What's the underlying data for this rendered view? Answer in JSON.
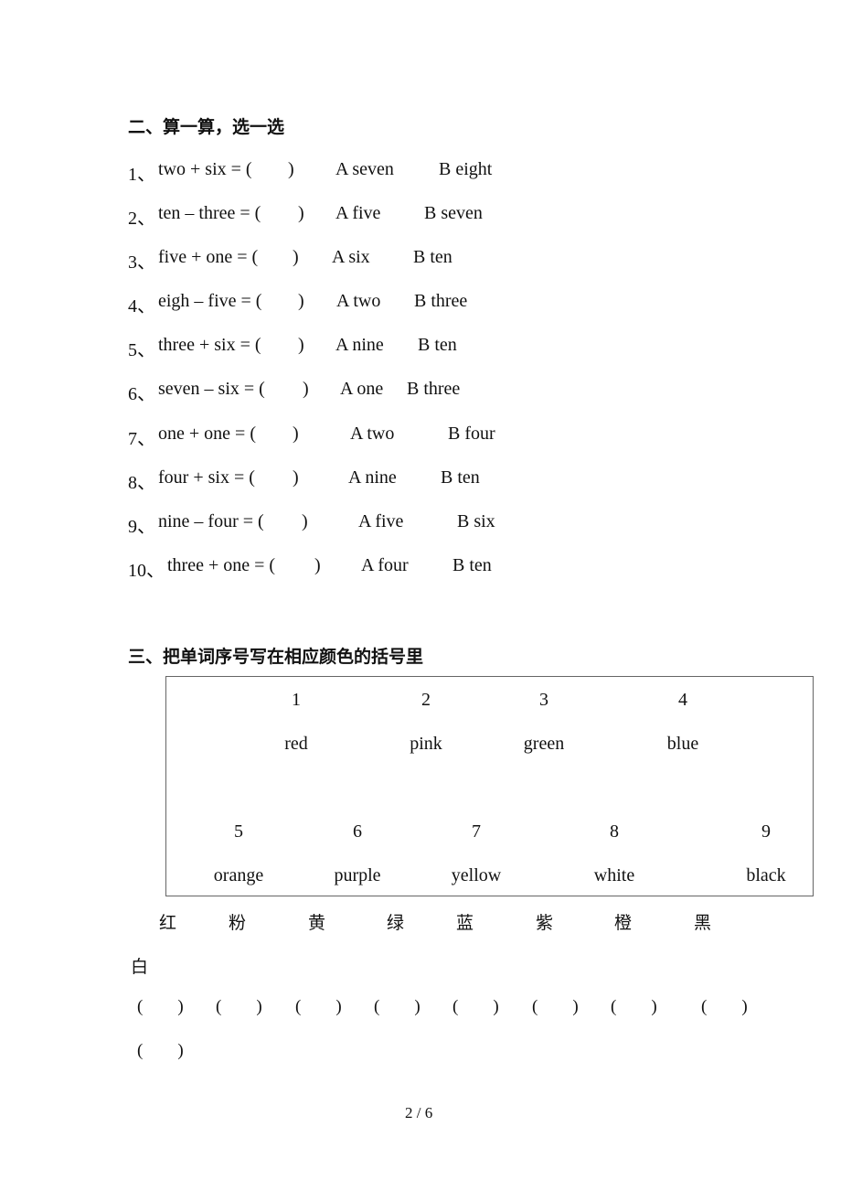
{
  "section2": {
    "title": "二、算一算，选一选",
    "questions": [
      {
        "num": "1、",
        "expr": "two + six = (",
        "close": ")",
        "a": "A seven",
        "b": "B eight"
      },
      {
        "num": "2、",
        "expr": "ten – three = (",
        "close": ")",
        "a": "A five",
        "b": "B seven"
      },
      {
        "num": "3、",
        "expr": "five + one = (",
        "close": ")",
        "a": "A six",
        "b": "B ten"
      },
      {
        "num": "4、",
        "expr": "eigh – five = (",
        "close": ")",
        "a": "A two",
        "b": "B three"
      },
      {
        "num": "5、",
        "expr": "three + six = (",
        "close": ")",
        "a": "A nine",
        "b": "B ten"
      },
      {
        "num": "6、",
        "expr": "seven – six = (",
        "close": ")",
        "a": "A one",
        "b": "B three"
      },
      {
        "num": "7、",
        "expr": "one + one = (",
        "close": ")",
        "a": "A two",
        "b": "B four"
      },
      {
        "num": "8、",
        "expr": "four + six = (",
        "close": ")",
        "a": "A nine",
        "b": "B ten"
      },
      {
        "num": "9、",
        "expr": "nine – four = (",
        "close": ")",
        "a": "A five",
        "b": "B six"
      },
      {
        "num": "10、",
        "expr": "three + one = (",
        "close": ")",
        "a": "A four",
        "b": "B ten"
      }
    ]
  },
  "section3": {
    "title": "三、把单词序号写在相应颜色的括号里",
    "words": [
      {
        "num": "1",
        "word": "red"
      },
      {
        "num": "2",
        "word": "pink"
      },
      {
        "num": "3",
        "word": "green"
      },
      {
        "num": "4",
        "word": "blue"
      },
      {
        "num": "5",
        "word": "orange"
      },
      {
        "num": "6",
        "word": "purple"
      },
      {
        "num": "7",
        "word": "yellow"
      },
      {
        "num": "8",
        "word": "white"
      },
      {
        "num": "9",
        "word": "black"
      }
    ],
    "chinese_colors": [
      "红",
      "粉",
      "黄",
      "绿",
      "蓝",
      "紫",
      "橙",
      "黑",
      "白"
    ],
    "blank": "(     )"
  },
  "footer": {
    "page": "2 / 6"
  }
}
